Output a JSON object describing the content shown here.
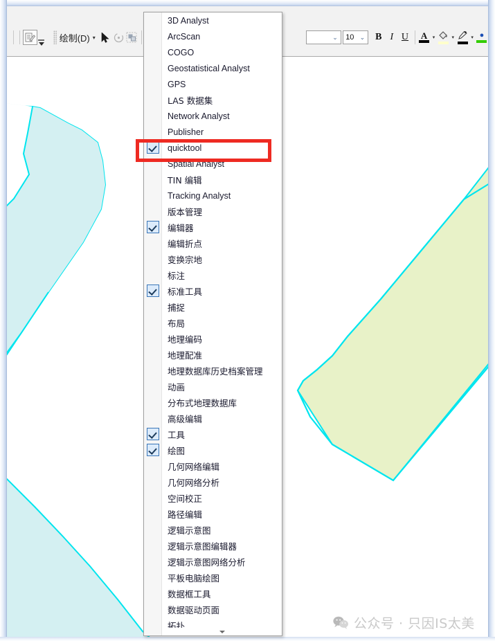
{
  "toolbar": {
    "gripper": "toolbar-gripper",
    "edit_sketch_icon": "edit-sketch-icon",
    "overflow_icon": "toolbar-overflow-icon",
    "draw_menu_label": "绘制(D)",
    "draw_caret": "▾",
    "select_arrow_icon": "select-arrow-icon",
    "rotate_icon": "rotate-icon",
    "select_elements_icon": "select-elements-icon",
    "font_family_value": "",
    "font_size_value": "10",
    "bold_label": "B",
    "italic_label": "I",
    "underline_label": "U",
    "font_color_glyph": "A",
    "font_color_swatch": "#000000",
    "fill_color_glyph": "◔",
    "fill_color_swatch": "#ffffcc",
    "line_color_glyph": "✎",
    "line_color_swatch": "#000000",
    "marker_color_swatch": "#33cc00",
    "dropdown_caret": "▾"
  },
  "menu": {
    "name": "toolbars-dropdown-menu",
    "scroll_down_hint": "▾",
    "items": [
      {
        "label": "3D Analyst",
        "checked": false,
        "cjk": false
      },
      {
        "label": "ArcScan",
        "checked": false,
        "cjk": false
      },
      {
        "label": "COGO",
        "checked": false,
        "cjk": false
      },
      {
        "label": "Geostatistical Analyst",
        "checked": false,
        "cjk": false
      },
      {
        "label": "GPS",
        "checked": false,
        "cjk": false
      },
      {
        "label": "LAS 数据集",
        "checked": false,
        "cjk": true
      },
      {
        "label": "Network Analyst",
        "checked": false,
        "cjk": false
      },
      {
        "label": "Publisher",
        "checked": false,
        "cjk": false
      },
      {
        "label": "quicktool",
        "checked": true,
        "cjk": false
      },
      {
        "label": "Spatial Analyst",
        "checked": false,
        "cjk": false
      },
      {
        "label": "TIN 编辑",
        "checked": false,
        "cjk": true
      },
      {
        "label": "Tracking Analyst",
        "checked": false,
        "cjk": false
      },
      {
        "label": "版本管理",
        "checked": false,
        "cjk": true
      },
      {
        "label": "编辑器",
        "checked": true,
        "cjk": true
      },
      {
        "label": "编辑折点",
        "checked": false,
        "cjk": true
      },
      {
        "label": "变换宗地",
        "checked": false,
        "cjk": true
      },
      {
        "label": "标注",
        "checked": false,
        "cjk": true
      },
      {
        "label": "标准工具",
        "checked": true,
        "cjk": true
      },
      {
        "label": "捕捉",
        "checked": false,
        "cjk": true
      },
      {
        "label": "布局",
        "checked": false,
        "cjk": true
      },
      {
        "label": "地理编码",
        "checked": false,
        "cjk": true
      },
      {
        "label": "地理配准",
        "checked": false,
        "cjk": true
      },
      {
        "label": "地理数据库历史档案管理",
        "checked": false,
        "cjk": true
      },
      {
        "label": "动画",
        "checked": false,
        "cjk": true
      },
      {
        "label": "分布式地理数据库",
        "checked": false,
        "cjk": true
      },
      {
        "label": "高级编辑",
        "checked": false,
        "cjk": true
      },
      {
        "label": "工具",
        "checked": true,
        "cjk": true
      },
      {
        "label": "绘图",
        "checked": true,
        "cjk": true
      },
      {
        "label": "几何网络编辑",
        "checked": false,
        "cjk": true
      },
      {
        "label": "几何网络分析",
        "checked": false,
        "cjk": true
      },
      {
        "label": "空间校正",
        "checked": false,
        "cjk": true
      },
      {
        "label": "路径编辑",
        "checked": false,
        "cjk": true
      },
      {
        "label": "逻辑示意图",
        "checked": false,
        "cjk": true
      },
      {
        "label": "逻辑示意图编辑器",
        "checked": false,
        "cjk": true
      },
      {
        "label": "逻辑示意图网络分析",
        "checked": false,
        "cjk": true
      },
      {
        "label": "平板电脑绘图",
        "checked": false,
        "cjk": true
      },
      {
        "label": "数据框工具",
        "checked": false,
        "cjk": true
      },
      {
        "label": "数据驱动页面",
        "checked": false,
        "cjk": true
      },
      {
        "label": "拓扑",
        "checked": false,
        "cjk": true
      }
    ]
  },
  "annotation": {
    "highlight_color": "#ee2a22",
    "highlight_target": "quicktool"
  },
  "map": {
    "water_fill": "#d4f0f2",
    "water_outline": "#00e5ee",
    "parcel_fill": "#e8f2c8",
    "parcel_outline": "#00e5ee",
    "background": "#ffffff"
  },
  "watermark": {
    "icon": "wechat-icon",
    "text": "公众号 · 只因IS太美",
    "color": "#c9c9c9"
  }
}
